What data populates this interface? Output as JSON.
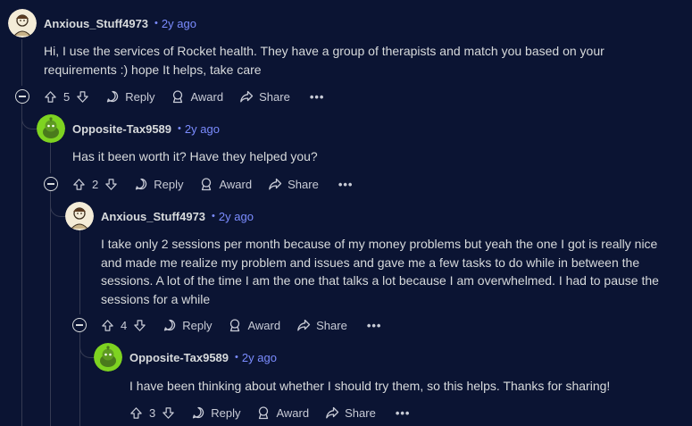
{
  "comments": [
    {
      "author": "Anxious_Stuff4973",
      "time": "2y ago",
      "text": "Hi, I use the services of Rocket health. They have a group of therapists and match you based on your requirements :) hope It helps, take care",
      "votes": "5"
    },
    {
      "author": "Opposite-Tax9589",
      "time": "2y ago",
      "text": "Has it been worth it? Have they helped you?",
      "votes": "2"
    },
    {
      "author": "Anxious_Stuff4973",
      "time": "2y ago",
      "text": "I take only 2 sessions per month because of my money problems but yeah the one I got is really nice and made me realize my problem and issues and gave me a few tasks to do while in between the sessions. A lot of the time I am the one that talks a lot because I am overwhelmed. I had to pause the sessions for a while",
      "votes": "4"
    },
    {
      "author": "Opposite-Tax9589",
      "time": "2y ago",
      "text": "I have been thinking about whether I should try them, so this helps. Thanks for sharing!",
      "votes": "3"
    }
  ],
  "actions": {
    "reply": "Reply",
    "award": "Award",
    "share": "Share",
    "more": "•••"
  },
  "separator": "•",
  "colors": {
    "background": "#0b1433",
    "timestamp": "#7b8cff",
    "snoo_green": "#7ed321",
    "thread_line": "#343a52"
  },
  "icons": [
    "avatar-sketch-icon",
    "snoo-green-icon",
    "upvote-icon",
    "downvote-icon",
    "reply-icon",
    "award-icon",
    "share-icon",
    "collapse-icon"
  ]
}
